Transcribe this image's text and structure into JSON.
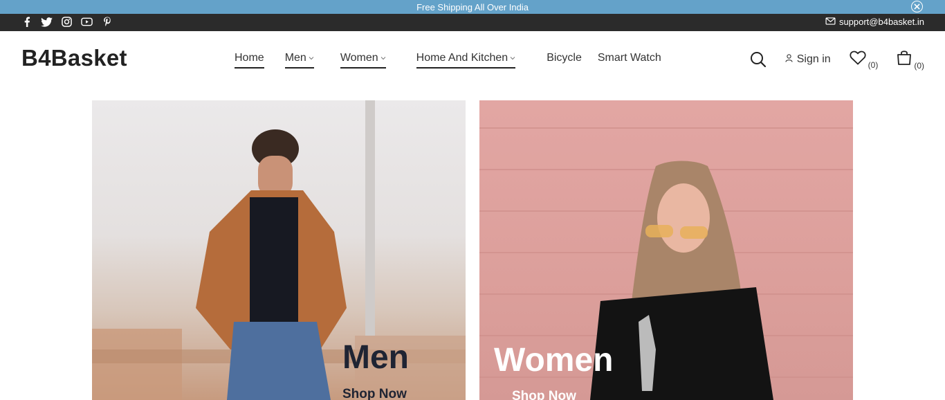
{
  "announcement": {
    "text": "Free Shipping All Over India"
  },
  "topbar": {
    "support_email": "support@b4basket.in"
  },
  "header": {
    "logo": "B4Basket",
    "nav": [
      {
        "label": "Home"
      },
      {
        "label": "Men"
      },
      {
        "label": "Women"
      },
      {
        "label": "Home And Kitchen"
      },
      {
        "label": "Bicycle"
      },
      {
        "label": "Smart Watch"
      }
    ],
    "signin": "Sign in",
    "wishlist_count": "(0)",
    "cart_count": "(0)"
  },
  "banners": [
    {
      "title": "Men",
      "cta": "Shop Now"
    },
    {
      "title": "Women",
      "cta": "Shop Now"
    }
  ],
  "colors": {
    "announce_bg": "#64a2c9",
    "topbar_bg": "#2b2b2b",
    "men_title": "#1f2433",
    "women_title": "#ffffff"
  }
}
